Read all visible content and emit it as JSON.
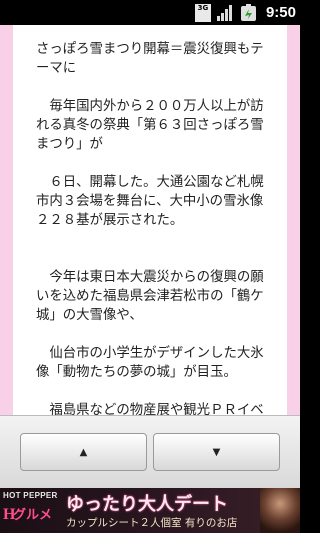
{
  "status_bar": {
    "network_type": "3G",
    "time": "9:50",
    "icons": [
      "3g-icon",
      "signal-icon",
      "battery-icon"
    ]
  },
  "article": {
    "paragraphs": [
      "さっぽろ雪まつり開幕＝震災復興もテーマに",
      "　毎年国内外から２００万人以上が訪れる真冬の祭典「第６３回さっぽろ雪まつり」が",
      "　６日、開幕した。大通公園など札幌市内３会場を舞台に、大中小の雪氷像２２８基が展示された。",
      "　今年は東日本大震災からの復興の願いを込めた福島県会津若松市の「鶴ケ城」の大雪像や、",
      "　仙台市の小学生がデザインした大氷像「動物たちの夢の城」が目玉。",
      "　福島県などの物産展や観光ＰＲイベントも開催された。"
    ]
  },
  "paging": {
    "up_label": "▲",
    "down_label": "▼"
  },
  "ad": {
    "brand_top": "HOT PEPPER",
    "brand_mark": "H",
    "brand_bottom": "グルメ",
    "headline": "ゆったり大人デート",
    "sub": "カップルシート２人個室 有りのお店"
  },
  "colors": {
    "side_bg": "#f8d0e8",
    "article_bg": "#ffffff",
    "accent_pink": "#ff4d8d"
  }
}
